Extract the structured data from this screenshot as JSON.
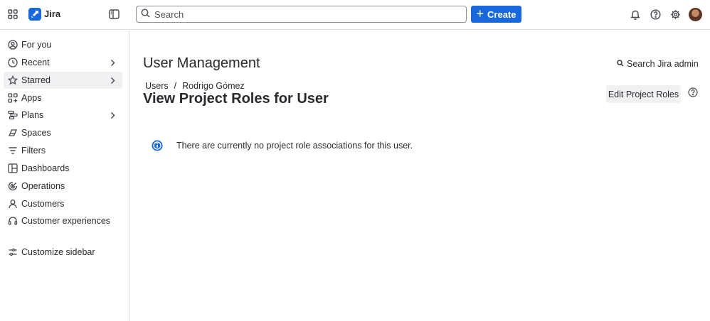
{
  "topbar": {
    "product_name": "Jira",
    "search_placeholder": "Search",
    "create_label": "Create"
  },
  "sidebar": {
    "items": [
      {
        "label": "For you",
        "icon": "person-circle-icon"
      },
      {
        "label": "Recent",
        "icon": "clock-icon"
      },
      {
        "label": "Starred",
        "icon": "star-icon"
      },
      {
        "label": "Apps",
        "icon": "apps-icon"
      },
      {
        "label": "Plans",
        "icon": "plans-icon"
      },
      {
        "label": "Spaces",
        "icon": "spaces-icon"
      },
      {
        "label": "Filters",
        "icon": "filter-icon"
      },
      {
        "label": "Dashboards",
        "icon": "dashboard-icon"
      },
      {
        "label": "Operations",
        "icon": "operations-icon"
      },
      {
        "label": "Customers",
        "icon": "person-icon"
      },
      {
        "label": "Customer experiences",
        "icon": "headset-icon"
      }
    ],
    "customize_label": "Customize sidebar"
  },
  "main": {
    "heading": "User Management",
    "admin_search_label": "Search Jira admin",
    "breadcrumb": {
      "items": [
        "Users",
        "Rodrigo Gómez"
      ],
      "separator": "/"
    },
    "title": "View Project Roles for User",
    "edit_button_label": "Edit Project Roles",
    "info_message": "There are currently no project role associations for this user."
  },
  "colors": {
    "brand_blue": "#1868db",
    "text": "#292a2e",
    "border": "#dddee1",
    "active_bg": "#f0f1f2"
  }
}
